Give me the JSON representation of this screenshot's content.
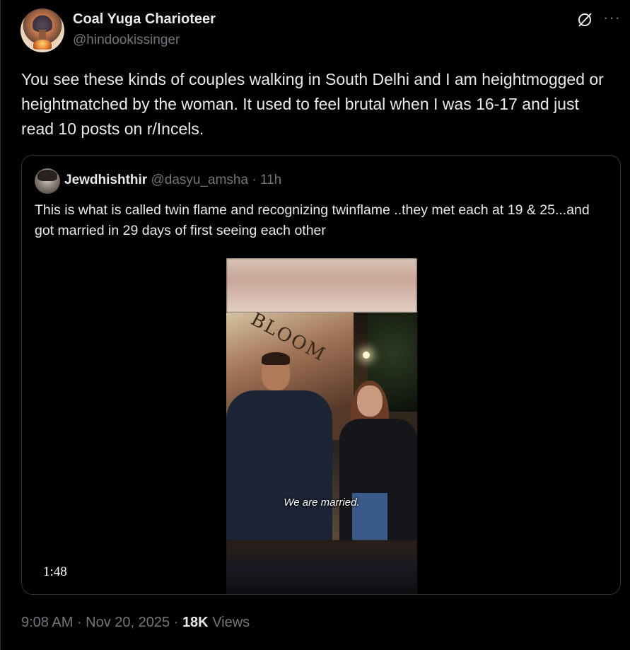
{
  "author": {
    "name": "Coal Yuga Charioteer",
    "handle": "@hindookissinger"
  },
  "post": {
    "text": "You see these kinds of couples walking in South Delhi and I am heightmogged or heightmatched by the woman. It used to feel brutal when I was 16-17 and just read 10 posts on r/Incels."
  },
  "quote": {
    "name": "Jewdhishthir",
    "handle": "@dasyu_amsha",
    "separator": " · ",
    "time": "11h",
    "text": "This is what is called twin flame and recognizing twinflame ..they met each at 19 & 25...and got married in 29 days of first seeing each other",
    "video": {
      "sign": "BLOOM",
      "caption": "We are married.",
      "duration": "1:48"
    }
  },
  "meta": {
    "time": "9:08 AM",
    "separator": " · ",
    "date": "Nov 20, 2025",
    "views_count": "18K",
    "views_label": " Views"
  },
  "icons": {
    "grok": "grok-icon",
    "more": "more-icon"
  },
  "colors": {
    "background": "#000000",
    "text": "#e7e9ea",
    "secondary": "#71767b",
    "border": "#2f3336"
  }
}
